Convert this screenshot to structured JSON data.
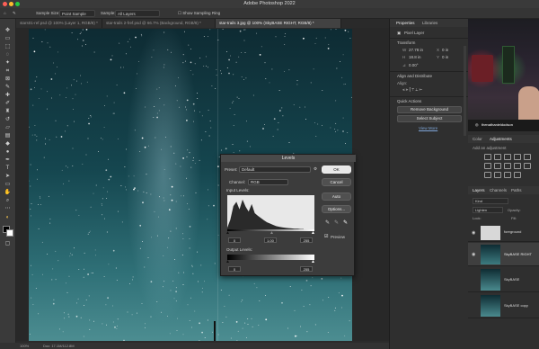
{
  "window": {
    "title": "Adobe Photoshop 2022"
  },
  "options_bar": {
    "sample_size_label": "Sample Size:",
    "sample_size_value": "Point Sample",
    "sample_label": "Sample:",
    "sample_value": "All Layers",
    "show_ring_label": "Show Sampling Ring"
  },
  "tabs": [
    {
      "label": "stars01-ref.psd @ 100% (Layer 1, RGB/8) *"
    },
    {
      "label": "star-trails 2-fref.psd @ 66.7% (Background, RGB/8) *"
    },
    {
      "label": "star-trails 3.jpg @ 100% (SkyBASE RIGHT, RGB/8) *"
    }
  ],
  "status": {
    "zoom": "100%",
    "doc": "Doc: 17.1M/112.8M"
  },
  "properties": {
    "tab_properties": "Properties",
    "tab_libraries": "Libraries",
    "layer_type": "Pixel Layer",
    "transform": "Transform",
    "w_value": "27.78 in",
    "h_value": "18.8 in",
    "x_value": "0 in",
    "y_value": "0 in",
    "angle_value": "0.00°",
    "align_distribute": "Align and Distribute",
    "align_label": "Align:",
    "quick_actions": "Quick Actions",
    "remove_bg": "Remove Background",
    "select_subject": "Select Subject",
    "view_more": "View More"
  },
  "webcam": {
    "handle": "thenathanieldodson"
  },
  "adjustments": {
    "tab_color": "Color",
    "tab_adjustments": "Adjustments",
    "add_label": "Add an adjustment"
  },
  "layers": {
    "tab_layers": "Layers",
    "tab_channels": "Channels",
    "tab_paths": "Paths",
    "kind": "Kind",
    "blend": "Lighten",
    "opacity_label": "Opacity:",
    "fill_label": "Fill:",
    "lock_label": "Lock:",
    "items": [
      {
        "name": "foreground"
      },
      {
        "name": "SkyBASE RIGHT"
      },
      {
        "name": "SkyBASE"
      },
      {
        "name": "SkyBASE copy"
      }
    ]
  },
  "levels": {
    "title": "Levels",
    "preset_label": "Preset:",
    "preset_value": "Default",
    "channel_label": "Channel:",
    "channel_value": "RGB",
    "input_label": "Input Levels:",
    "input_black": "0",
    "input_gamma": "1.00",
    "input_white": "255",
    "output_label": "Output Levels:",
    "output_black": "0",
    "output_white": "255",
    "ok": "OK",
    "cancel": "Cancel",
    "auto": "Auto",
    "options": "Options...",
    "preview": "Preview"
  },
  "colors": {
    "accent_red": "#c8303a",
    "accent_green": "#3fb34a",
    "sky_dark": "#0e2b33",
    "sky_light": "#4c8d91"
  }
}
